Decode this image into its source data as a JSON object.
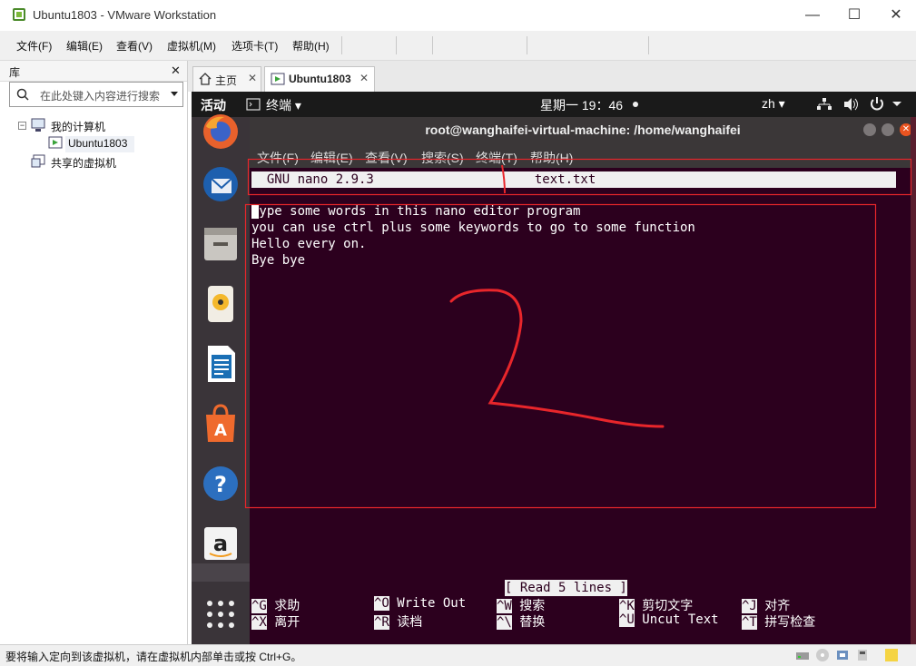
{
  "window": {
    "title": "Ubuntu1803 - VMware Workstation",
    "minimize": "—",
    "maximize": "☐",
    "close": "✕"
  },
  "menubar": {
    "items": [
      "文件(F)",
      "编辑(E)",
      "查看(V)",
      "虚拟机(M)",
      "选项卡(T)",
      "帮助(H)"
    ]
  },
  "library": {
    "title": "库",
    "close": "✕",
    "search_placeholder": "在此处键入内容进行搜索",
    "tree": {
      "my_computer": "我的计算机",
      "vm": "Ubuntu1803",
      "shared": "共享的虚拟机"
    }
  },
  "tabs": [
    {
      "label": "主页",
      "close": "✕"
    },
    {
      "label": "Ubuntu1803",
      "close": "✕"
    }
  ],
  "ubuntu": {
    "activities": "活动",
    "app_menu": "终端 ▾",
    "clock": "星期一 19：46",
    "lang": "zh ▾"
  },
  "terminal": {
    "title": "root@wanghaifei-virtual-machine: /home/wanghaifei",
    "menu": [
      "文件(F)",
      "编辑(E)",
      "查看(V)",
      "搜索(S)",
      "终端(T)",
      "帮助(H)"
    ],
    "nano_header": "  GNU nano 2.9.3                     text.txt",
    "lines": [
      "Type some words in this nano editor program",
      "you can use ctrl plus some keywords to go to some function",
      "Hello every on.",
      "Bye bye"
    ],
    "status": "[ Read 5 lines ]",
    "shortcuts": [
      {
        "key": "^G",
        "label": "求助"
      },
      {
        "key": "^O",
        "label": "Write Out"
      },
      {
        "key": "^W",
        "label": "搜索"
      },
      {
        "key": "^K",
        "label": "剪切文字"
      },
      {
        "key": "^J",
        "label": "对齐"
      },
      {
        "key": "^X",
        "label": "离开"
      },
      {
        "key": "^R",
        "label": "读档"
      },
      {
        "key": "^\\",
        "label": "替换"
      },
      {
        "key": "^U",
        "label": "Uncut Text"
      },
      {
        "key": "^T",
        "label": "拼写检查"
      }
    ]
  },
  "statusbar": {
    "text": "要将输入定向到该虚拟机，请在虚拟机内部单击或按 Ctrl+G。"
  },
  "colors": {
    "ubuntu_bg": "#2c001e",
    "annotation": "#e8262b",
    "dock": "#3a3439"
  },
  "icons": [
    "firefox-icon",
    "thunderbird-icon",
    "files-icon",
    "rhythmbox-icon",
    "writer-icon",
    "software-icon",
    "help-icon",
    "amazon-icon",
    "apps-grid-icon"
  ]
}
